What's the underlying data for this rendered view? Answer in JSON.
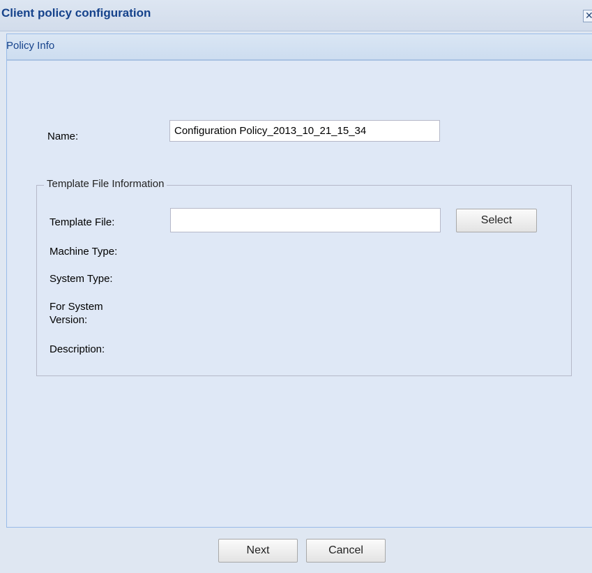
{
  "window": {
    "title": "Client policy configuration",
    "close_glyph": "✕"
  },
  "panel": {
    "title": "Policy Info"
  },
  "form": {
    "name_label": "Name:",
    "name_value": "Configuration Policy_2013_10_21_15_34",
    "template_section": {
      "legend": "Template File Information",
      "template_file_label": "Template File:",
      "template_file_value": "",
      "select_label": "Select",
      "machine_type_label": "Machine Type:",
      "system_type_label": "System Type:",
      "system_version_label": "For System Version:",
      "description_label": "Description:"
    }
  },
  "footer": {
    "next_label": "Next",
    "cancel_label": "Cancel"
  },
  "colors": {
    "title_text": "#15428b",
    "panel_bg": "#dfe8f6",
    "border": "#99bbe8"
  }
}
